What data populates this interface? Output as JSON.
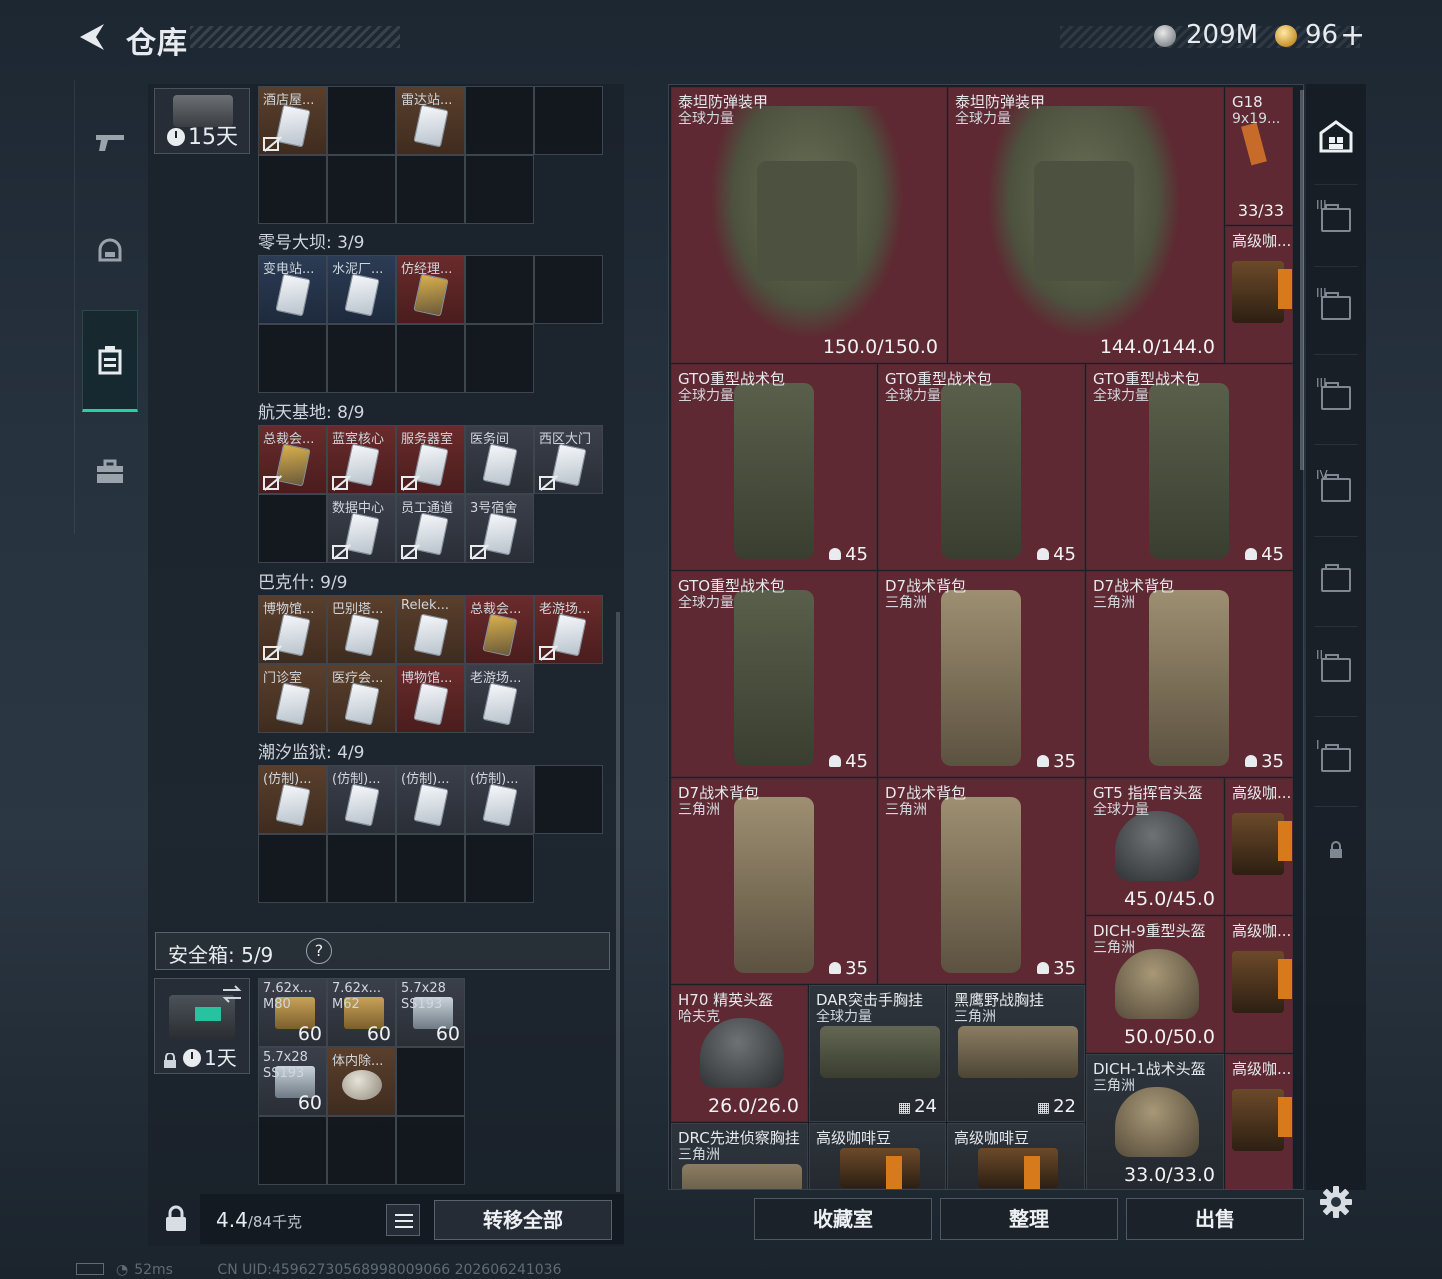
{
  "header": {
    "title": "仓库",
    "silver_amount": "209M",
    "gold_amount": "96",
    "plus_label": "+"
  },
  "keycase": {
    "time": "15天"
  },
  "top_keys": [
    "酒店屋...",
    "雷达站..."
  ],
  "sections": [
    {
      "title": "零号大坝: 3/9",
      "items": [
        "变电站...",
        "水泥厂...",
        "仿经理..."
      ]
    },
    {
      "title": "航天基地: 8/9",
      "items": [
        "总裁会...",
        "蓝室核心",
        "服务器室",
        "医务间",
        "西区大门",
        "数据中心",
        "员工通道",
        "3号宿舍"
      ]
    },
    {
      "title": "巴克什: 9/9",
      "items": [
        "博物馆...",
        "巴别塔...",
        "Relek...",
        "总裁会...",
        "老游场...",
        "门诊室",
        "医疗会...",
        "博物馆...",
        "老游场..."
      ]
    },
    {
      "title": "潮汐监狱: 4/9",
      "items": [
        "(仿制)...",
        "(仿制)...",
        "(仿制)...",
        "(仿制)..."
      ]
    }
  ],
  "safebox": {
    "title": "安全箱:  5/9",
    "help": "?",
    "time": "1天",
    "items": [
      {
        "label": "7.62x... M80",
        "qty": "60"
      },
      {
        "label": "7.62x... M62",
        "qty": "60"
      },
      {
        "label": "5.7x28 SS193",
        "qty": "60"
      },
      {
        "label": "5.7x28 SS193",
        "qty": "60"
      },
      {
        "label": "体内除...",
        "qty": ""
      }
    ]
  },
  "footer_left": {
    "weight": "4.4",
    "weight_max": "/84千克",
    "transfer_label": "转移全部"
  },
  "status": {
    "ping": "52ms",
    "uid": "CN UID:4596273056899800906​6 202606241036"
  },
  "stash": [
    {
      "name": "泰坦防弹装甲",
      "sub": "全球力量",
      "value": "150.0/150.0",
      "kind": "armor"
    },
    {
      "name": "泰坦防弹装甲",
      "sub": "全球力量",
      "value": "144.0/144.0",
      "kind": "armor"
    },
    {
      "name": "G18",
      "sub": "9x19...",
      "value": "33/33",
      "kind": "gun"
    },
    {
      "name": "高级咖...",
      "sub": "",
      "value": "",
      "kind": "coffee"
    },
    {
      "name": "GTO重型战术包",
      "sub": "全球力量",
      "value": "45",
      "kind": "pack"
    },
    {
      "name": "GTO重型战术包",
      "sub": "全球力量",
      "value": "45",
      "kind": "pack"
    },
    {
      "name": "GTO重型战术包",
      "sub": "全球力量",
      "value": "45",
      "kind": "pack"
    },
    {
      "name": "GTO重型战术包",
      "sub": "全球力量",
      "value": "45",
      "kind": "pack"
    },
    {
      "name": "D7战术背包",
      "sub": "三角洲",
      "value": "35",
      "kind": "pack-tan"
    },
    {
      "name": "D7战术背包",
      "sub": "三角洲",
      "value": "35",
      "kind": "pack-tan"
    },
    {
      "name": "D7战术背包",
      "sub": "三角洲",
      "value": "35",
      "kind": "pack-tan"
    },
    {
      "name": "D7战术背包",
      "sub": "三角洲",
      "value": "35",
      "kind": "pack-tan"
    },
    {
      "name": "GT5 指挥官头盔",
      "sub": "全球力量",
      "value": "45.0/45.0",
      "kind": "helmet"
    },
    {
      "name": "高级咖...",
      "sub": "",
      "value": "",
      "kind": "coffee"
    },
    {
      "name": "DICH-9重型头盔",
      "sub": "三角洲",
      "value": "50.0/50.0",
      "kind": "helmet-tan"
    },
    {
      "name": "高级咖...",
      "sub": "",
      "value": "",
      "kind": "coffee"
    },
    {
      "name": "H70 精英头盔",
      "sub": "哈夫克",
      "value": "26.0/26.0",
      "kind": "helmet"
    },
    {
      "name": "DAR突击手胸挂",
      "sub": "全球力量",
      "value": "24",
      "kind": "rig"
    },
    {
      "name": "黑鹰野战胸挂",
      "sub": "三角洲",
      "value": "22",
      "kind": "rig-tan"
    },
    {
      "name": "DICH-1战术头盔",
      "sub": "三角洲",
      "value": "33.0/33.0",
      "kind": "helmet-tan"
    },
    {
      "name": "高级咖...",
      "sub": "",
      "value": "",
      "kind": "coffee"
    },
    {
      "name": "DRC先进侦察胸挂",
      "sub": "三角洲",
      "value": "",
      "kind": "rig-tan"
    },
    {
      "name": "高级咖啡豆",
      "sub": "",
      "value": "",
      "kind": "coffee"
    },
    {
      "name": "高级咖啡豆",
      "sub": "",
      "value": "",
      "kind": "coffee"
    }
  ],
  "tabs": [
    "III",
    "III",
    "III",
    "IV",
    "",
    "II",
    "I"
  ],
  "buttons": {
    "collection": "收藏室",
    "sort": "整理",
    "sell": "出售"
  },
  "colors": {
    "accent": "#29d0a4",
    "stash_bg": "#5e2932"
  }
}
